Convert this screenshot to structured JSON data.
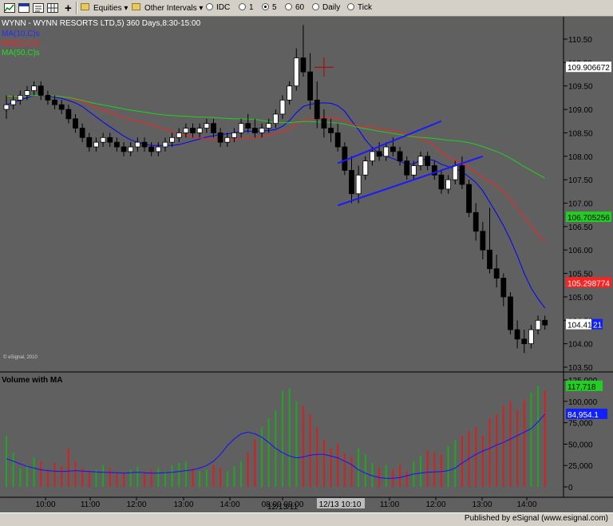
{
  "toolbar": {
    "equities_label": "Equities",
    "other_intervals_label": "Other Intervals",
    "intervals": [
      "IDC",
      "1",
      "5",
      "60",
      "Daily",
      "Tick"
    ]
  },
  "chart_data": [
    {
      "type": "candlestick",
      "title": "WYNN - WYNN RESORTS LTD,5) 360 Days,8:30-15:00",
      "series_labels": [
        "MA(10,C)s",
        "MA(21,C)s",
        "MA(50,C)s"
      ],
      "series_colors": [
        "#0000ff",
        "#ff2020",
        "#20d020"
      ],
      "y_ticks": [
        "110.50",
        "110.00",
        "109.50",
        "109.00",
        "108.50",
        "108.00",
        "107.50",
        "107.00",
        "106.50",
        "106.00",
        "105.50",
        "105.00",
        "104.50",
        "104.00",
        "103.50"
      ],
      "ylim": [
        103.5,
        110.5
      ],
      "x_tick_labels": [
        "10:00",
        "11:00",
        "12:00",
        "13:00",
        "14:00",
        "08:00 09:00",
        "12/13 10:10",
        "11:00",
        "12:00",
        "13:00",
        "14:00"
      ],
      "x_sub_label": "12/13/11",
      "value_markers": [
        {
          "label": "109.906672",
          "value": 109.9,
          "color": "#ffffff"
        },
        {
          "label": "106.705256",
          "value": 106.7,
          "color": "#20d020"
        },
        {
          "label": "105.298774",
          "value": 105.3,
          "color": "#ff2020"
        },
        {
          "label": "104.41",
          "value": 104.41,
          "color": "#ffffff"
        },
        {
          "label": "21",
          "value": 104.41,
          "color": "#1020ff"
        }
      ],
      "watermark": "© eSignal, 2010",
      "candles": [
        [
          109.0,
          109.3,
          108.8,
          109.1
        ],
        [
          109.1,
          109.3,
          109.0,
          109.2
        ],
        [
          109.2,
          109.4,
          109.1,
          109.3
        ],
        [
          109.3,
          109.5,
          109.2,
          109.4
        ],
        [
          109.4,
          109.6,
          109.3,
          109.5
        ],
        [
          109.5,
          109.6,
          109.2,
          109.3
        ],
        [
          109.3,
          109.4,
          109.1,
          109.2
        ],
        [
          109.2,
          109.3,
          109.0,
          109.1
        ],
        [
          109.1,
          109.2,
          108.9,
          109.0
        ],
        [
          109.0,
          109.1,
          108.7,
          108.8
        ],
        [
          108.8,
          108.9,
          108.5,
          108.6
        ],
        [
          108.6,
          108.7,
          108.3,
          108.4
        ],
        [
          108.4,
          108.5,
          108.1,
          108.2
        ],
        [
          108.2,
          108.4,
          108.1,
          108.3
        ],
        [
          108.3,
          108.5,
          108.2,
          108.4
        ],
        [
          108.4,
          108.5,
          108.2,
          108.3
        ],
        [
          108.3,
          108.4,
          108.1,
          108.2
        ],
        [
          108.2,
          108.3,
          108.0,
          108.1
        ],
        [
          108.1,
          108.3,
          108.0,
          108.2
        ],
        [
          108.2,
          108.4,
          108.1,
          108.3
        ],
        [
          108.3,
          108.4,
          108.1,
          108.2
        ],
        [
          108.2,
          108.3,
          108.0,
          108.1
        ],
        [
          108.1,
          108.3,
          108.0,
          108.2
        ],
        [
          108.2,
          108.4,
          108.1,
          108.3
        ],
        [
          108.3,
          108.5,
          108.2,
          108.4
        ],
        [
          108.4,
          108.6,
          108.3,
          108.5
        ],
        [
          108.5,
          108.7,
          108.4,
          108.6
        ],
        [
          108.6,
          108.7,
          108.4,
          108.5
        ],
        [
          108.5,
          108.7,
          108.4,
          108.6
        ],
        [
          108.6,
          108.8,
          108.5,
          108.7
        ],
        [
          108.7,
          108.8,
          108.4,
          108.5
        ],
        [
          108.5,
          108.6,
          108.2,
          108.3
        ],
        [
          108.3,
          108.5,
          108.2,
          108.4
        ],
        [
          108.4,
          108.6,
          108.3,
          108.5
        ],
        [
          108.5,
          108.8,
          108.4,
          108.7
        ],
        [
          108.7,
          108.9,
          108.5,
          108.6
        ],
        [
          108.6,
          108.8,
          108.4,
          108.5
        ],
        [
          108.5,
          108.7,
          108.4,
          108.6
        ],
        [
          108.6,
          108.8,
          108.5,
          108.7
        ],
        [
          108.7,
          109.0,
          108.6,
          108.9
        ],
        [
          108.9,
          109.3,
          108.8,
          109.2
        ],
        [
          109.2,
          109.6,
          109.1,
          109.5
        ],
        [
          109.5,
          110.3,
          109.4,
          110.1
        ],
        [
          110.1,
          110.8,
          109.7,
          109.8
        ],
        [
          109.8,
          110.2,
          109.0,
          109.2
        ],
        [
          109.2,
          109.6,
          108.6,
          108.8
        ],
        [
          108.8,
          109.0,
          108.4,
          108.6
        ],
        [
          108.6,
          108.8,
          108.3,
          108.5
        ],
        [
          108.5,
          108.7,
          108.1,
          108.2
        ],
        [
          108.2,
          108.3,
          107.6,
          107.7
        ],
        [
          107.7,
          108.0,
          107.0,
          107.2
        ],
        [
          107.2,
          107.8,
          107.0,
          107.6
        ],
        [
          107.6,
          108.0,
          107.5,
          107.9
        ],
        [
          107.9,
          108.2,
          107.8,
          108.1
        ],
        [
          108.1,
          108.3,
          107.9,
          108.0
        ],
        [
          108.0,
          108.3,
          107.9,
          108.2
        ],
        [
          108.2,
          108.4,
          108.0,
          108.1
        ],
        [
          108.1,
          108.2,
          107.8,
          107.9
        ],
        [
          107.9,
          108.0,
          107.5,
          107.6
        ],
        [
          107.6,
          107.9,
          107.5,
          107.8
        ],
        [
          107.8,
          108.1,
          107.7,
          108.0
        ],
        [
          108.0,
          108.1,
          107.7,
          107.8
        ],
        [
          107.8,
          107.9,
          107.5,
          107.6
        ],
        [
          107.6,
          107.7,
          107.2,
          107.3
        ],
        [
          107.3,
          107.6,
          107.2,
          107.5
        ],
        [
          107.5,
          107.9,
          107.4,
          107.8
        ],
        [
          107.8,
          108.0,
          107.3,
          107.4
        ],
        [
          107.4,
          107.5,
          106.7,
          106.8
        ],
        [
          106.8,
          107.0,
          106.2,
          106.4
        ],
        [
          106.4,
          106.6,
          105.8,
          106.0
        ],
        [
          106.0,
          106.9,
          105.5,
          105.6
        ],
        [
          105.6,
          105.9,
          105.2,
          105.4
        ],
        [
          105.4,
          105.5,
          104.8,
          105.0
        ],
        [
          105.0,
          105.1,
          104.2,
          104.3
        ],
        [
          104.3,
          104.5,
          103.9,
          104.1
        ],
        [
          104.1,
          104.3,
          103.8,
          104.0
        ],
        [
          104.0,
          104.4,
          103.9,
          104.3
        ],
        [
          104.3,
          104.6,
          104.2,
          104.5
        ],
        [
          104.5,
          104.6,
          104.3,
          104.4
        ]
      ],
      "drawn_lines": [
        {
          "from": [
            48,
            107.85
          ],
          "to": [
            63,
            108.75
          ],
          "color": "#1a1aff"
        },
        {
          "from": [
            48,
            106.95
          ],
          "to": [
            69,
            108.0
          ],
          "color": "#1a1aff"
        }
      ],
      "crosshair_marker": {
        "x_index": 46,
        "value": 109.9,
        "color": "#b00000"
      }
    },
    {
      "type": "bar",
      "title": "Volume with MA",
      "y_ticks": [
        "125,000",
        "100,000",
        "75,000",
        "50,000",
        "25,000",
        "0"
      ],
      "ylim": [
        0,
        125000
      ],
      "value_markers": [
        {
          "label": "117,718",
          "value": 117718,
          "color": "#20d020"
        },
        {
          "label": "84,954.1",
          "value": 84954,
          "color": "#1020ff"
        }
      ],
      "volume": [
        60000,
        40000,
        22000,
        25000,
        34000,
        30000,
        20000,
        28000,
        24000,
        45000,
        30000,
        22000,
        18000,
        20000,
        25000,
        22000,
        16000,
        17000,
        20000,
        24000,
        16000,
        20000,
        22000,
        18000,
        25000,
        28000,
        30000,
        22000,
        18000,
        20000,
        26000,
        22000,
        18000,
        24000,
        30000,
        40000,
        55000,
        70000,
        80000,
        90000,
        112000,
        115000,
        100000,
        95000,
        85000,
        70000,
        55000,
        45000,
        50000,
        40000,
        35000,
        45000,
        38000,
        28000,
        22000,
        25000,
        20000,
        26000,
        18000,
        30000,
        36000,
        42000,
        40000,
        38000,
        48000,
        55000,
        60000,
        65000,
        70000,
        60000,
        80000,
        85000,
        95000,
        100000,
        90000,
        102000,
        110000,
        118000,
        112000
      ],
      "volume_ma": [
        33000,
        30000,
        27000,
        24000,
        22000,
        20000,
        19000,
        18500,
        18000,
        18500,
        19000,
        18500,
        18000,
        17500,
        17000,
        16800,
        16500,
        16000,
        16500,
        17000,
        16500,
        16000,
        16000,
        16500,
        17000,
        18000,
        19000,
        20000,
        22000,
        25000,
        30000,
        38000,
        48000,
        56000,
        62000,
        64000,
        62000,
        58000,
        52000,
        45000,
        40000,
        36000,
        34000,
        35000,
        37000,
        38000,
        38000,
        36000,
        34000,
        30000,
        26000,
        20000,
        16000,
        13000,
        11000,
        10000,
        10000,
        11000,
        13000,
        15000,
        16000,
        17000,
        17500,
        18000,
        19000,
        22000,
        28000,
        33000,
        38000,
        42000,
        45000,
        49000,
        52000,
        56000,
        60000,
        64000,
        68000,
        76000,
        85000
      ],
      "volume_colors_up_down": "green=up red=down"
    }
  ],
  "footer": {
    "published_by": "Published by eSignal (www.esignal.com)"
  }
}
